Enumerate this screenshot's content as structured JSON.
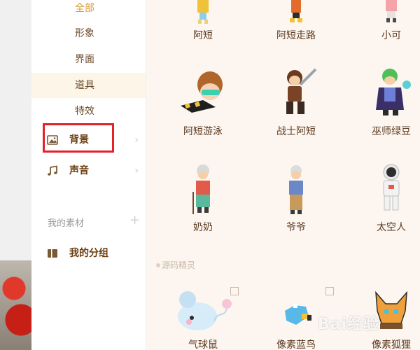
{
  "sidebar": {
    "sub_items": [
      {
        "label": "全部"
      },
      {
        "label": "形象"
      },
      {
        "label": "界面"
      },
      {
        "label": "道具"
      },
      {
        "label": "特效"
      }
    ],
    "categories": [
      {
        "label": "背景",
        "icon": "image-icon"
      },
      {
        "label": "声音",
        "icon": "music-note-icon"
      }
    ],
    "my_material": "我的素材",
    "my_groups": "我的分组"
  },
  "main": {
    "row1": [
      "阿短",
      "阿短走路",
      "小可"
    ],
    "row2": [
      "阿短游泳",
      "战士阿短",
      "巫师绿豆"
    ],
    "row3": [
      "奶奶",
      "爷爷",
      "太空人"
    ],
    "section_title": "源码精灵",
    "row4_partial": [
      "气球鼠",
      "像素蓝鸟",
      "像素狐狸"
    ]
  },
  "watermark": "Bai经验"
}
